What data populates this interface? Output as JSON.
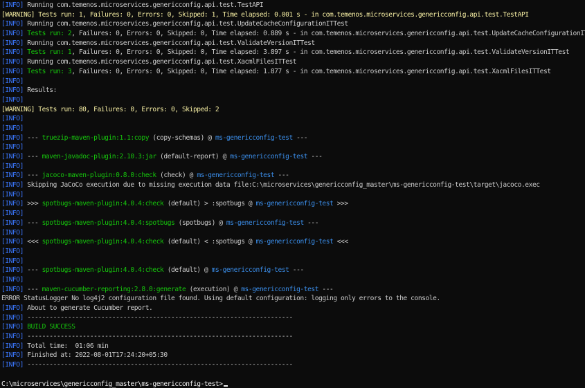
{
  "terminal": {
    "lines": [
      [
        [
          "info",
          "[INFO] "
        ],
        [
          "plain",
          "Running com.temenos.microservices.genericconfig.api.test.TestAPI"
        ]
      ],
      [
        [
          "warn",
          "[WARNING] Tests run: 1, Failures: 0, Errors: 0, Skipped: 1, Time elapsed: 0.001 s - in com.temenos.microservices.genericconfig.api.test.TestAPI"
        ]
      ],
      [
        [
          "info",
          "[INFO] "
        ],
        [
          "plain",
          "Running com.temenos.microservices.genericconfig.api.test.UpdateCacheConfigurationITTest"
        ]
      ],
      [
        [
          "info",
          "[INFO] "
        ],
        [
          "green",
          "Tests run: 2"
        ],
        [
          "plain",
          ", Failures: 0, Errors: 0, Skipped: 0, Time elapsed: 0.889 s - in com.temenos.microservices.genericconfig.api.test.UpdateCacheConfigurationITTest"
        ]
      ],
      [
        [
          "info",
          "[INFO] "
        ],
        [
          "plain",
          "Running com.temenos.microservices.genericconfig.api.test.ValidateVersionITTest"
        ]
      ],
      [
        [
          "info",
          "[INFO] "
        ],
        [
          "green",
          "Tests run: 1"
        ],
        [
          "plain",
          ", Failures: 0, Errors: 0, Skipped: 0, Time elapsed: 3.897 s - in com.temenos.microservices.genericconfig.api.test.ValidateVersionITTest"
        ]
      ],
      [
        [
          "info",
          "[INFO] "
        ],
        [
          "plain",
          "Running com.temenos.microservices.genericconfig.api.test.XacmlFilesITTest"
        ]
      ],
      [
        [
          "info",
          "[INFO] "
        ],
        [
          "green",
          "Tests run: 3"
        ],
        [
          "plain",
          ", Failures: 0, Errors: 0, Skipped: 0, Time elapsed: 1.877 s - in com.temenos.microservices.genericconfig.api.test.XacmlFilesITTest"
        ]
      ],
      [
        [
          "info",
          "[INFO]"
        ]
      ],
      [
        [
          "info",
          "[INFO] "
        ],
        [
          "plain",
          "Results:"
        ]
      ],
      [
        [
          "info",
          "[INFO]"
        ]
      ],
      [
        [
          "warn",
          "[WARNING] Tests run: 80, Failures: 0, Errors: 0, Skipped: 2"
        ]
      ],
      [
        [
          "info",
          "[INFO]"
        ]
      ],
      [
        [
          "info",
          "[INFO]"
        ]
      ],
      [
        [
          "info",
          "[INFO] "
        ],
        [
          "plain",
          "--- "
        ],
        [
          "green",
          "truezip-maven-plugin:1.1:copy"
        ],
        [
          "plain",
          " (copy-schemas) @ "
        ],
        [
          "cyan",
          "ms-genericconfig-test"
        ],
        [
          "plain",
          " ---"
        ]
      ],
      [
        [
          "info",
          "[INFO]"
        ]
      ],
      [
        [
          "info",
          "[INFO] "
        ],
        [
          "plain",
          "--- "
        ],
        [
          "green",
          "maven-javadoc-plugin:2.10.3:jar"
        ],
        [
          "plain",
          " (default-report) @ "
        ],
        [
          "cyan",
          "ms-genericconfig-test"
        ],
        [
          "plain",
          " ---"
        ]
      ],
      [
        [
          "info",
          "[INFO]"
        ]
      ],
      [
        [
          "info",
          "[INFO] "
        ],
        [
          "plain",
          "--- "
        ],
        [
          "green",
          "jacoco-maven-plugin:0.8.0:check"
        ],
        [
          "plain",
          " (check) @ "
        ],
        [
          "cyan",
          "ms-genericconfig-test"
        ],
        [
          "plain",
          " ---"
        ]
      ],
      [
        [
          "info",
          "[INFO] "
        ],
        [
          "plain",
          "Skipping JaCoCo execution due to missing execution data file:C:\\microservices\\genericconfig_master\\ms-genericconfig-test\\target\\jacoco.exec"
        ]
      ],
      [
        [
          "info",
          "[INFO]"
        ]
      ],
      [
        [
          "info",
          "[INFO] "
        ],
        [
          "plain",
          ">>> "
        ],
        [
          "green",
          "spotbugs-maven-plugin:4.0.4:check"
        ],
        [
          "plain",
          " (default) > :spotbugs @ "
        ],
        [
          "cyan",
          "ms-genericconfig-test"
        ],
        [
          "plain",
          " >>>"
        ]
      ],
      [
        [
          "info",
          "[INFO]"
        ]
      ],
      [
        [
          "info",
          "[INFO] "
        ],
        [
          "plain",
          "--- "
        ],
        [
          "green",
          "spotbugs-maven-plugin:4.0.4:spotbugs"
        ],
        [
          "plain",
          " (spotbugs) @ "
        ],
        [
          "cyan",
          "ms-genericconfig-test"
        ],
        [
          "plain",
          " ---"
        ]
      ],
      [
        [
          "info",
          "[INFO]"
        ]
      ],
      [
        [
          "info",
          "[INFO] "
        ],
        [
          "plain",
          "<<< "
        ],
        [
          "green",
          "spotbugs-maven-plugin:4.0.4:check"
        ],
        [
          "plain",
          " (default) < :spotbugs @ "
        ],
        [
          "cyan",
          "ms-genericconfig-test"
        ],
        [
          "plain",
          " <<<"
        ]
      ],
      [
        [
          "info",
          "[INFO]"
        ]
      ],
      [
        [
          "info",
          "[INFO]"
        ]
      ],
      [
        [
          "info",
          "[INFO] "
        ],
        [
          "plain",
          "--- "
        ],
        [
          "green",
          "spotbugs-maven-plugin:4.0.4:check"
        ],
        [
          "plain",
          " (default) @ "
        ],
        [
          "cyan",
          "ms-genericconfig-test"
        ],
        [
          "plain",
          " ---"
        ]
      ],
      [
        [
          "info",
          "[INFO]"
        ]
      ],
      [
        [
          "info",
          "[INFO] "
        ],
        [
          "plain",
          "--- "
        ],
        [
          "green",
          "maven-cucumber-reporting:2.8.0:generate"
        ],
        [
          "plain",
          " (execution) @ "
        ],
        [
          "cyan",
          "ms-genericconfig-test"
        ],
        [
          "plain",
          " ---"
        ]
      ],
      [
        [
          "plain",
          "ERROR StatusLogger No log4j2 configuration file found. Using default configuration: logging only errors to the console."
        ]
      ],
      [
        [
          "info",
          "[INFO] "
        ],
        [
          "plain",
          "About to generate Cucumber report."
        ]
      ],
      [
        [
          "info",
          "[INFO] "
        ],
        [
          "plain",
          "------------------------------------------------------------------------"
        ]
      ],
      [
        [
          "info",
          "[INFO] "
        ],
        [
          "green",
          "BUILD SUCCESS"
        ]
      ],
      [
        [
          "info",
          "[INFO] "
        ],
        [
          "plain",
          "------------------------------------------------------------------------"
        ]
      ],
      [
        [
          "info",
          "[INFO] "
        ],
        [
          "plain",
          "Total time:  01:06 min"
        ]
      ],
      [
        [
          "info",
          "[INFO] "
        ],
        [
          "plain",
          "Finished at: 2022-08-01T17:24:20+05:30"
        ]
      ],
      [
        [
          "info",
          "[INFO] "
        ],
        [
          "plain",
          "------------------------------------------------------------------------"
        ]
      ],
      [
        [
          "plain",
          ""
        ]
      ],
      [
        [
          "white",
          "C:\\microservices\\genericconfig_master\\ms-genericconfig-test>"
        ]
      ]
    ]
  },
  "colors": {
    "background": "#0c0c0c",
    "info": "#3b78ff",
    "warning": "#f9f1a5",
    "success": "#16c60c",
    "project": "#3b8eea",
    "text": "#cccccc",
    "prompt": "#f2f2f2"
  }
}
